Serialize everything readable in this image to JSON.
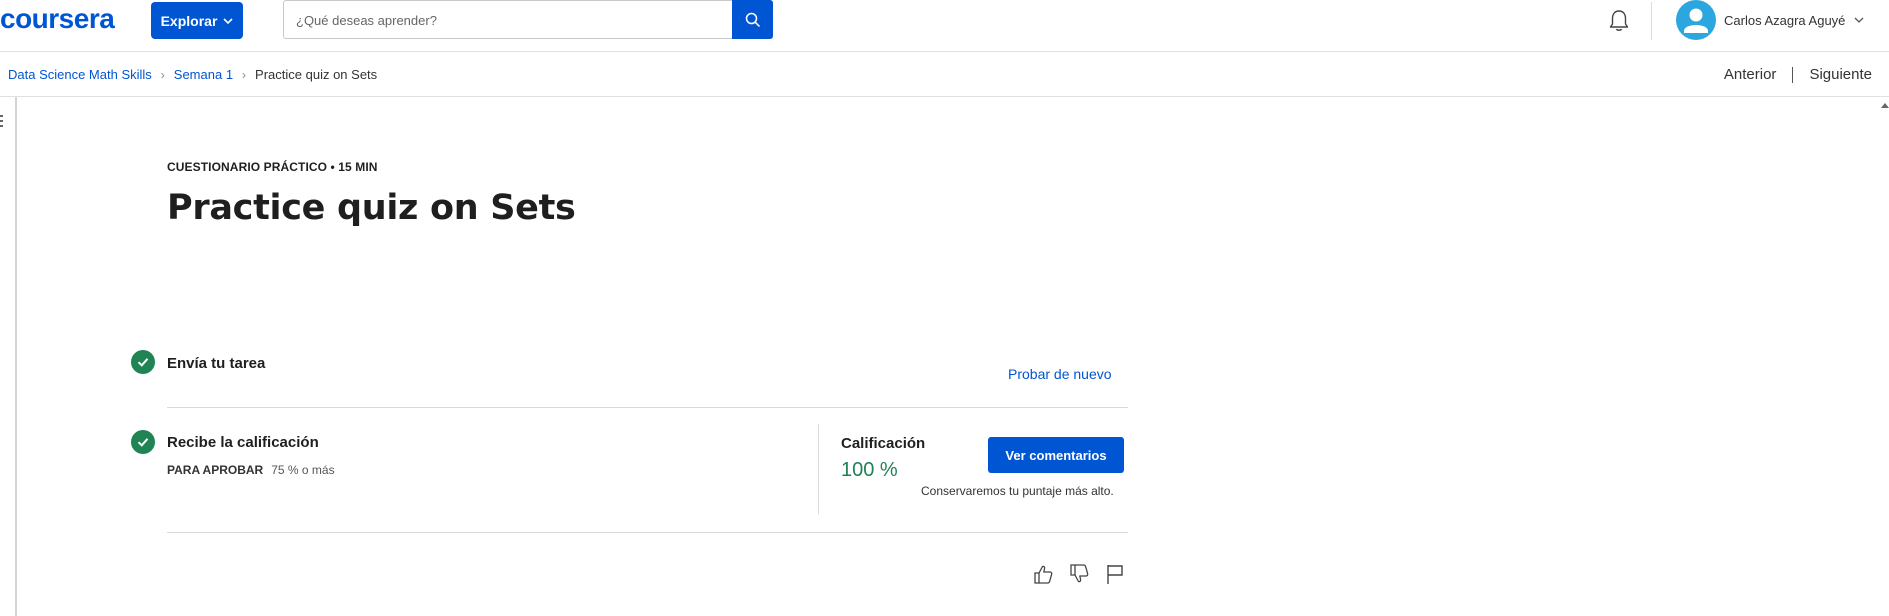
{
  "header": {
    "logo": "coursera",
    "explore_label": "Explorar",
    "search_placeholder": "¿Qué deseas aprender?",
    "user_name": "Carlos Azagra Aguyé"
  },
  "breadcrumb": {
    "items": [
      "Data Science Math Skills",
      "Semana 1"
    ],
    "current": "Practice quiz on Sets"
  },
  "nav": {
    "prev": "Anterior",
    "next": "Siguiente"
  },
  "quiz": {
    "meta": "CUESTIONARIO PRÁCTICO • 15 MIN",
    "title": "Practice quiz on Sets"
  },
  "submit_step": {
    "title": "Envía tu tarea",
    "retry_label": "Probar de nuevo"
  },
  "grade_step": {
    "title": "Recibe la calificación",
    "pass_label": "PARA APROBAR",
    "pass_value": "75 % o más",
    "grade_label": "Calificación",
    "grade_value": "100 %",
    "view_feedback_label": "Ver comentarios",
    "keep_note": "Conservaremos tu puntaje más alto."
  },
  "colors": {
    "brand": "#0056d2",
    "success": "#1f8354"
  }
}
